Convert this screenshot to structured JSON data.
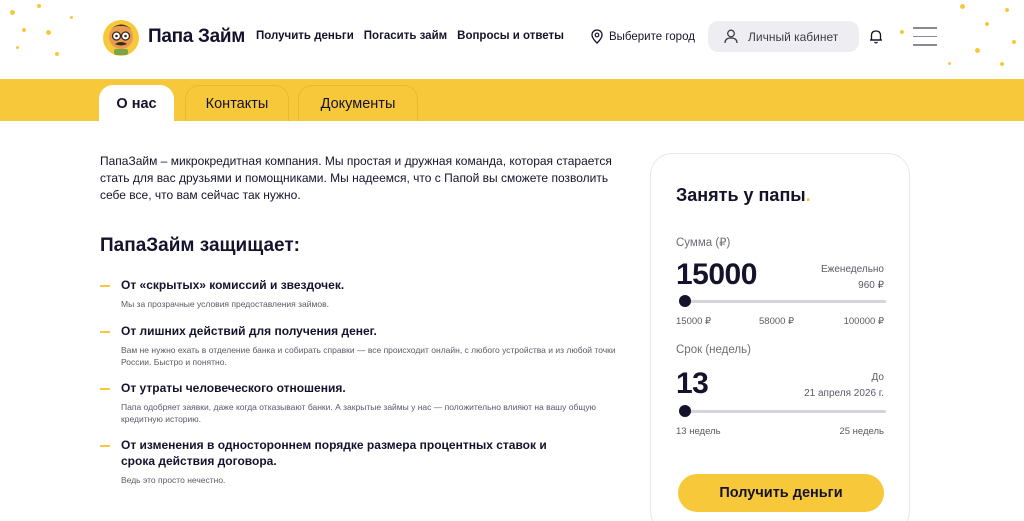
{
  "header": {
    "logo_text": "Папа Займ",
    "nav": [
      "Получить деньги",
      "Погасить займ",
      "Вопросы и ответы"
    ],
    "city": "Выберите город",
    "cabinet": "Личный кабинет",
    "icons": [
      "logo-papa-icon",
      "location-pin-icon",
      "user-icon",
      "bell-icon",
      "menu-icon"
    ]
  },
  "tabs": [
    "О нас",
    "Контакты",
    "Документы"
  ],
  "intro": "ПапаЗайм – микрокредитная компания. Мы простая и дружная команда, которая старается стать для вас друзьями и помощниками. Мы надеемся, что с Папой вы сможете позволить себе все, что вам сейчас так нужно.",
  "protects": {
    "title": "ПапаЗайм защищает:",
    "items": [
      {
        "title": "От «скрытых» комиссий и звездочек.",
        "desc": "Мы за прозрачные условия предоставления займов."
      },
      {
        "title": "От лишних действий для получения денег.",
        "desc": "Вам не нужно ехать в отделение банка и собирать справки — все происходит онлайн, с любого устройства и из любой точки России. Быстро и понятно."
      },
      {
        "title": "От утраты человеческого отношения.",
        "desc": "Папа одобряет заявки, даже когда отказывают банки. А закрытые займы у нас — положительно влияют на вашу общую кредитную историю."
      },
      {
        "title": "От изменения в одностороннем порядке размера процентных ставок и срока действия договора.",
        "desc": "Ведь это просто нечестно."
      }
    ]
  },
  "calculator": {
    "title": "Занять у папы",
    "title_dot": ".",
    "amount_label": "Сумма (₽)",
    "amount_value": "15000",
    "amount_side_1": "Еженедельно",
    "amount_side_2": "960 ₽",
    "amount_ticks": [
      "15000 ₽",
      "58000 ₽",
      "100000 ₽"
    ],
    "amount_fraction": 0.0,
    "term_label": "Срок (недель)",
    "term_value": "13",
    "term_side_1": "До",
    "term_side_2": "21 апреля 2026 г.",
    "term_ticks": [
      "13 недель",
      "25 недель"
    ],
    "term_fraction": 0.0,
    "cta": "Получить деньги"
  },
  "colors": {
    "accent": "#f7c93a",
    "text": "#14132b",
    "muted": "#5a5a66"
  }
}
